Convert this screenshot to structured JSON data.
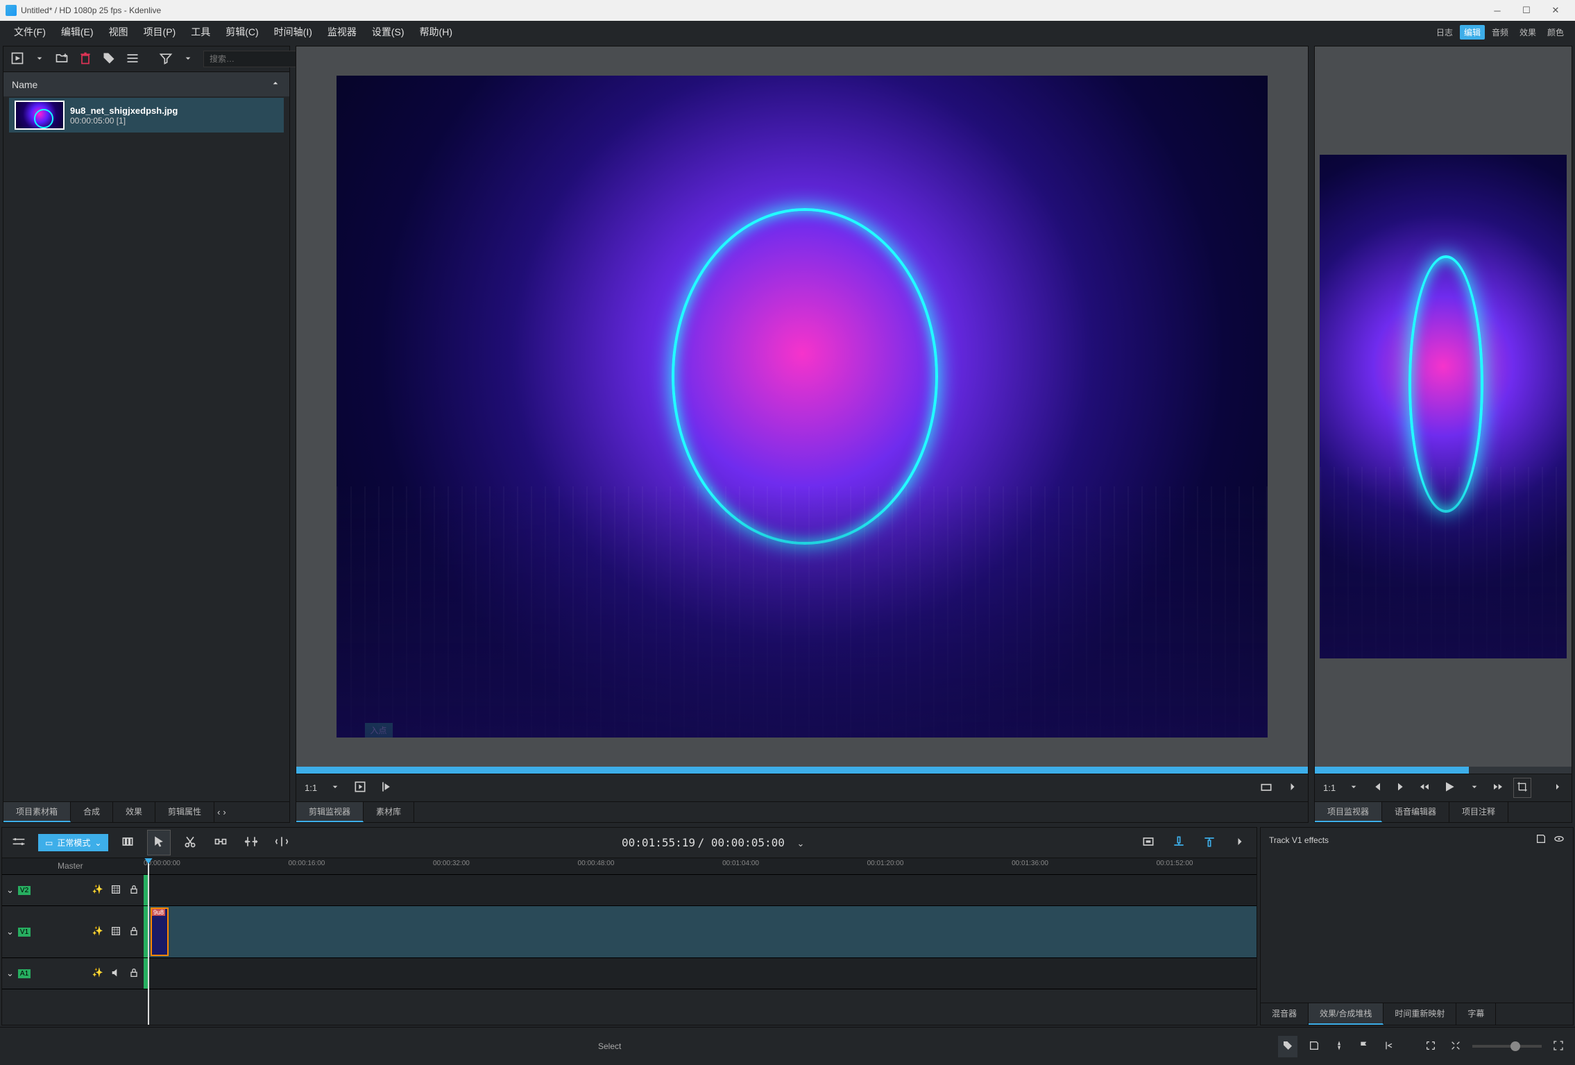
{
  "titlebar": {
    "title": "Untitled* / HD 1080p 25 fps - Kdenlive"
  },
  "menu": {
    "file": "文件(F)",
    "edit": "编辑(E)",
    "view": "视图",
    "project": "项目(P)",
    "tools": "工具",
    "clip": "剪辑(C)",
    "timeline": "时间轴(I)",
    "monitor": "监视器",
    "settings": "设置(S)",
    "help": "帮助(H)"
  },
  "tags": {
    "log": "日志",
    "edit": "编辑",
    "audio": "音频",
    "effects": "效果",
    "color": "颜色"
  },
  "project_bin": {
    "search_placeholder": "搜索…",
    "name_header": "Name",
    "clip": {
      "name": "9u8_net_shigjxedpsh.jpg",
      "duration": "00:00:05:00 [1]"
    }
  },
  "left_tabs": {
    "bin": "项目素材箱",
    "compose": "合成",
    "effects": "效果",
    "props": "剪辑属性"
  },
  "clip_monitor": {
    "in_point": "入点",
    "zoom": "1:1"
  },
  "clip_monitor_tabs": {
    "monitor": "剪辑监视器",
    "library": "素材库"
  },
  "project_monitor": {
    "zoom": "1:1"
  },
  "project_monitor_tabs": {
    "monitor": "项目监视器",
    "voice": "语音编辑器",
    "notes": "项目注释"
  },
  "timeline": {
    "mode": "正常模式",
    "timecode": "00:01:55:19",
    "duration": "00:00:05:00",
    "master": "Master",
    "ticks": [
      "00:00:00:00",
      "00:00:16:00",
      "00:00:32:00",
      "00:00:48:00",
      "00:01:04:00",
      "00:01:20:00",
      "00:01:36:00",
      "00:01:52:00"
    ],
    "tracks": {
      "v2": "V2",
      "v1": "V1",
      "a1": "A1"
    },
    "clip_label": "9u8"
  },
  "effects_panel": {
    "header": "Track V1 effects",
    "tabs": {
      "mixer": "混音器",
      "stack": "效果/合成堆栈",
      "remap": "时间重新映射",
      "subtitle": "字幕"
    }
  },
  "statusbar": {
    "select": "Select"
  }
}
